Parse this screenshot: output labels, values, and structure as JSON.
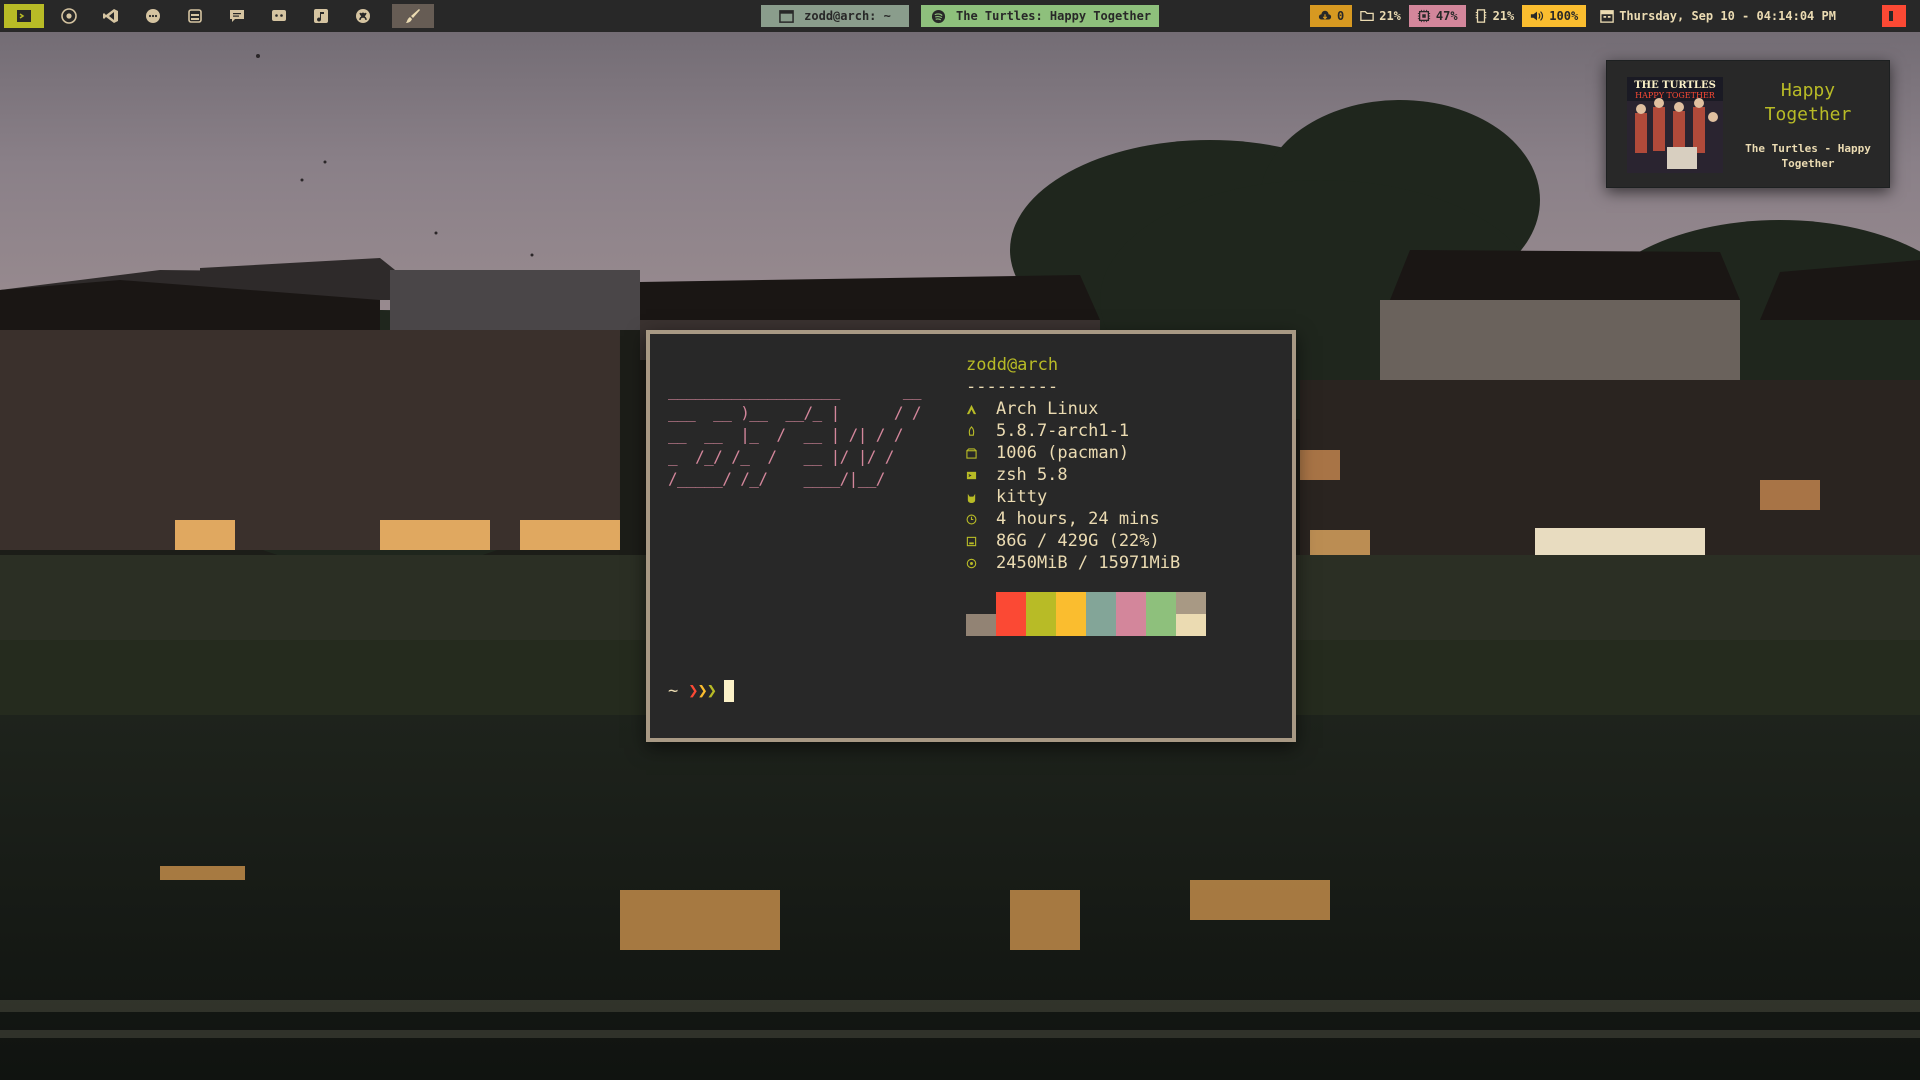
{
  "topbar": {
    "launchers": [
      "terminal-icon",
      "chromium-icon",
      "vscode-icon",
      "discord-chat-icon",
      "archive-icon",
      "notes-icon",
      "discord-icon",
      "music-icon",
      "github-icon",
      "paint-icon"
    ],
    "tasks": [
      {
        "label": "zodd@arch: ~",
        "icon": "terminal-window-icon"
      },
      {
        "label": "The Turtles: Happy Together",
        "icon": "spotify-icon"
      }
    ],
    "modules": {
      "updates": "0",
      "disk": "21%",
      "cpu": "47%",
      "memory": "21%",
      "volume": "100%",
      "clock": "Thursday, Sep 10 - 04:14:04 PM"
    }
  },
  "notification": {
    "title": "Happy Together",
    "body": "The Turtles - Happy Together",
    "cover_band": "THE TURTLES",
    "cover_album": "HAPPY TOGETHER"
  },
  "terminal": {
    "ascii_art": "___________________       __\n___  __ )__  __/_ |      / /\n__  __  |_  /  __ | /| / / \n_  /_/ /_  /   __ |/ |/ /  \n/_____/ /_/    ____/|__/   ",
    "host": "zodd@arch",
    "separator": "---------",
    "info": [
      {
        "icon": "arch-icon",
        "value": "Arch Linux"
      },
      {
        "icon": "kernel-icon",
        "value": "5.8.7-arch1-1"
      },
      {
        "icon": "package-icon",
        "value": "1006 (pacman)"
      },
      {
        "icon": "shell-icon",
        "value": "zsh 5.8"
      },
      {
        "icon": "cat-icon",
        "value": "kitty"
      },
      {
        "icon": "clock-icon",
        "value": "4 hours, 24 mins"
      },
      {
        "icon": "disk-icon",
        "value": "86G / 429G (22%)"
      },
      {
        "icon": "memory-icon",
        "value": "2450MiB / 15971MiB"
      }
    ],
    "palette": [
      {
        "top": "#282828",
        "bottom": "#928374"
      },
      {
        "top": "#fb4934",
        "bottom": "#fb4934"
      },
      {
        "top": "#b8bb26",
        "bottom": "#b8bb26"
      },
      {
        "top": "#fabd2f",
        "bottom": "#fabd2f"
      },
      {
        "top": "#83a598",
        "bottom": "#83a598"
      },
      {
        "top": "#d3869b",
        "bottom": "#d3869b"
      },
      {
        "top": "#8ec07c",
        "bottom": "#8ec07c"
      },
      {
        "top": "#a89984",
        "bottom": "#ebdbb2"
      }
    ],
    "prompt_symbol": "~",
    "prompt_arrows": "❯❯❯"
  },
  "colors": {
    "bar_bg": "#282828",
    "accent_green": "#b8bb26",
    "accent_yellow": "#d79921",
    "accent_pink": "#d3869b",
    "accent_red": "#fb4934"
  }
}
